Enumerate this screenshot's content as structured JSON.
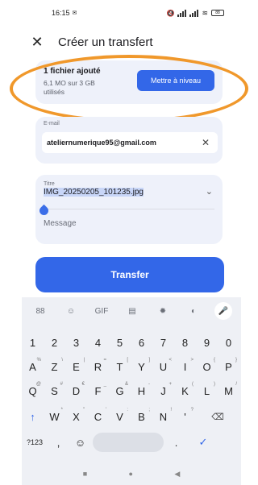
{
  "status_bar": {
    "time": "16:15",
    "mail_icon": "mail-notification-icon",
    "battery": "88"
  },
  "header": {
    "close_icon": "✕",
    "title": "Créer un transfert"
  },
  "upgrade": {
    "files_added": "1 fichier ajouté",
    "usage": "6,1 MO sur 3 GB utilisés",
    "button_label": "Mettre à niveau",
    "accent": "#3367e8",
    "highlight_color": "#f0982b"
  },
  "email": {
    "label": "E-mail",
    "recipient": "ateliernumerique95@gmail.com",
    "remove_icon": "✕"
  },
  "title_field": {
    "label": "Titre",
    "value": "IMG_20250205_101235.jpg",
    "message_placeholder": "Message"
  },
  "transfer_button": {
    "label": "Transfer"
  },
  "keyboard": {
    "toolbar": [
      "88",
      "☺",
      "GIF",
      "▤",
      "✹",
      "◐",
      "●"
    ],
    "row_numbers": [
      "1",
      "2",
      "3",
      "4",
      "5",
      "6",
      "7",
      "8",
      "9",
      "0"
    ],
    "row_a": [
      [
        "A",
        "%"
      ],
      [
        "Z",
        "\\"
      ],
      [
        "E",
        "|"
      ],
      [
        "R",
        "="
      ],
      [
        "T",
        "["
      ],
      [
        "Y",
        "]"
      ],
      [
        "U",
        "<"
      ],
      [
        "I",
        ">"
      ],
      [
        "O",
        "{"
      ],
      [
        "P",
        "}"
      ]
    ],
    "row_q": [
      [
        "Q",
        "@"
      ],
      [
        "S",
        "#"
      ],
      [
        "D",
        "€"
      ],
      [
        "F",
        "_"
      ],
      [
        "G",
        "&"
      ],
      [
        "H",
        "-"
      ],
      [
        "J",
        "+"
      ],
      [
        "K",
        "("
      ],
      [
        "L",
        ")"
      ],
      [
        "M",
        "/"
      ]
    ],
    "row_w": [
      [
        "W",
        "*"
      ],
      [
        "X",
        "\""
      ],
      [
        "C",
        "'"
      ],
      [
        "V",
        ":"
      ],
      [
        "B",
        ";"
      ],
      [
        "N",
        "!"
      ],
      [
        "'",
        "?"
      ]
    ],
    "shift": "↑",
    "backspace": "⌫",
    "sym_key": "?123",
    "comma": ",",
    "emoji": "☺",
    "period": ".",
    "enter": "✓"
  },
  "nav": {
    "recents": "■",
    "home": "●",
    "back": "◀"
  }
}
